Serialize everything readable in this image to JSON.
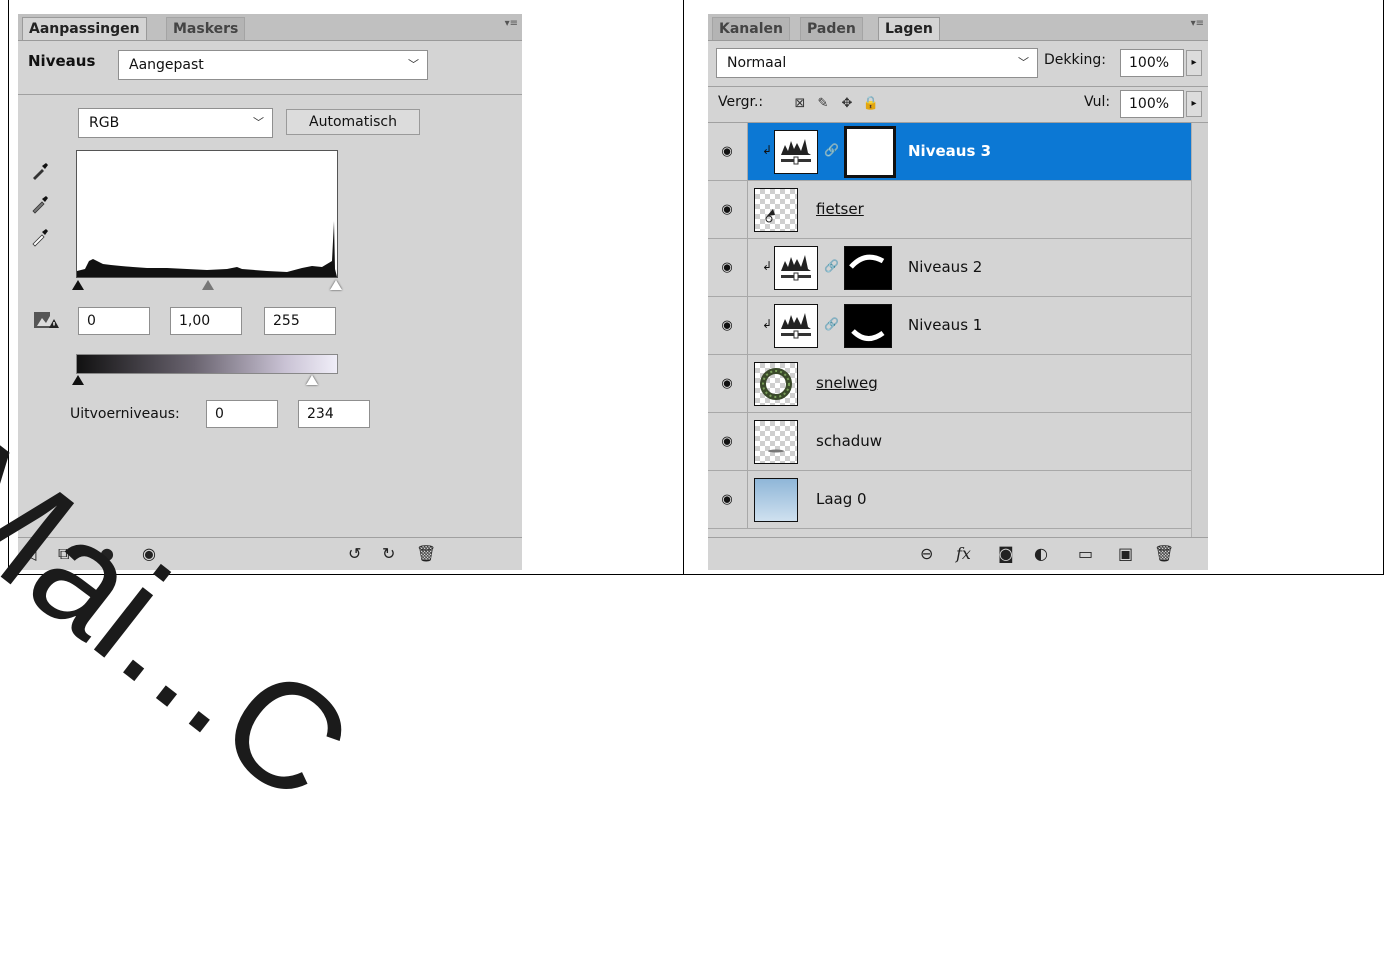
{
  "left_panel": {
    "tabs": [
      "Aanpassingen",
      "Maskers"
    ],
    "menu_icon": "panel-menu-icon",
    "title": "Niveaus",
    "preset": "Aangepast",
    "channel": "RGB",
    "auto_label": "Automatisch",
    "input_black": "0",
    "input_gamma": "1,00",
    "input_white": "255",
    "output_label": "Uitvoerniveaus:",
    "output_black": "0",
    "output_white": "234",
    "histogram_peak_right": true,
    "bottom_icons": [
      "back-arrow-icon",
      "clip-to-layer-icon",
      "view-previous-icon",
      "visibility-eye-icon",
      "reset-previous-icon",
      "reset-icon",
      "trash-icon"
    ]
  },
  "right_panel": {
    "tabs": [
      "Kanalen",
      "Paden",
      "Lagen"
    ],
    "blend_mode": "Normaal",
    "opacity_label": "Dekking:",
    "opacity_value": "100%",
    "lock_label": "Vergr.:",
    "fill_label": "Vul:",
    "fill_value": "100%",
    "layers": [
      {
        "name": "Niveaus 3",
        "selected": true,
        "type": "adjustment"
      },
      {
        "name": "fietser",
        "selected": false,
        "type": "pixel"
      },
      {
        "name": "Niveaus 2",
        "selected": false,
        "type": "adjustment"
      },
      {
        "name": "Niveaus 1",
        "selected": false,
        "type": "adjustment"
      },
      {
        "name": "snelweg",
        "selected": false,
        "type": "pixel"
      },
      {
        "name": "schaduw",
        "selected": false,
        "type": "pixel"
      },
      {
        "name": "Laag 0",
        "selected": false,
        "type": "pixel"
      }
    ],
    "bottom_icons": [
      "link-icon",
      "fx-icon",
      "mask-icon",
      "adjustment-icon",
      "group-folder-icon",
      "new-layer-icon",
      "trash-icon"
    ]
  },
  "watermark": "Mai...C",
  "colors": {
    "selection": "#0c78d4",
    "panel": "#d4d4d4",
    "watermark": "#1b1b1b"
  }
}
